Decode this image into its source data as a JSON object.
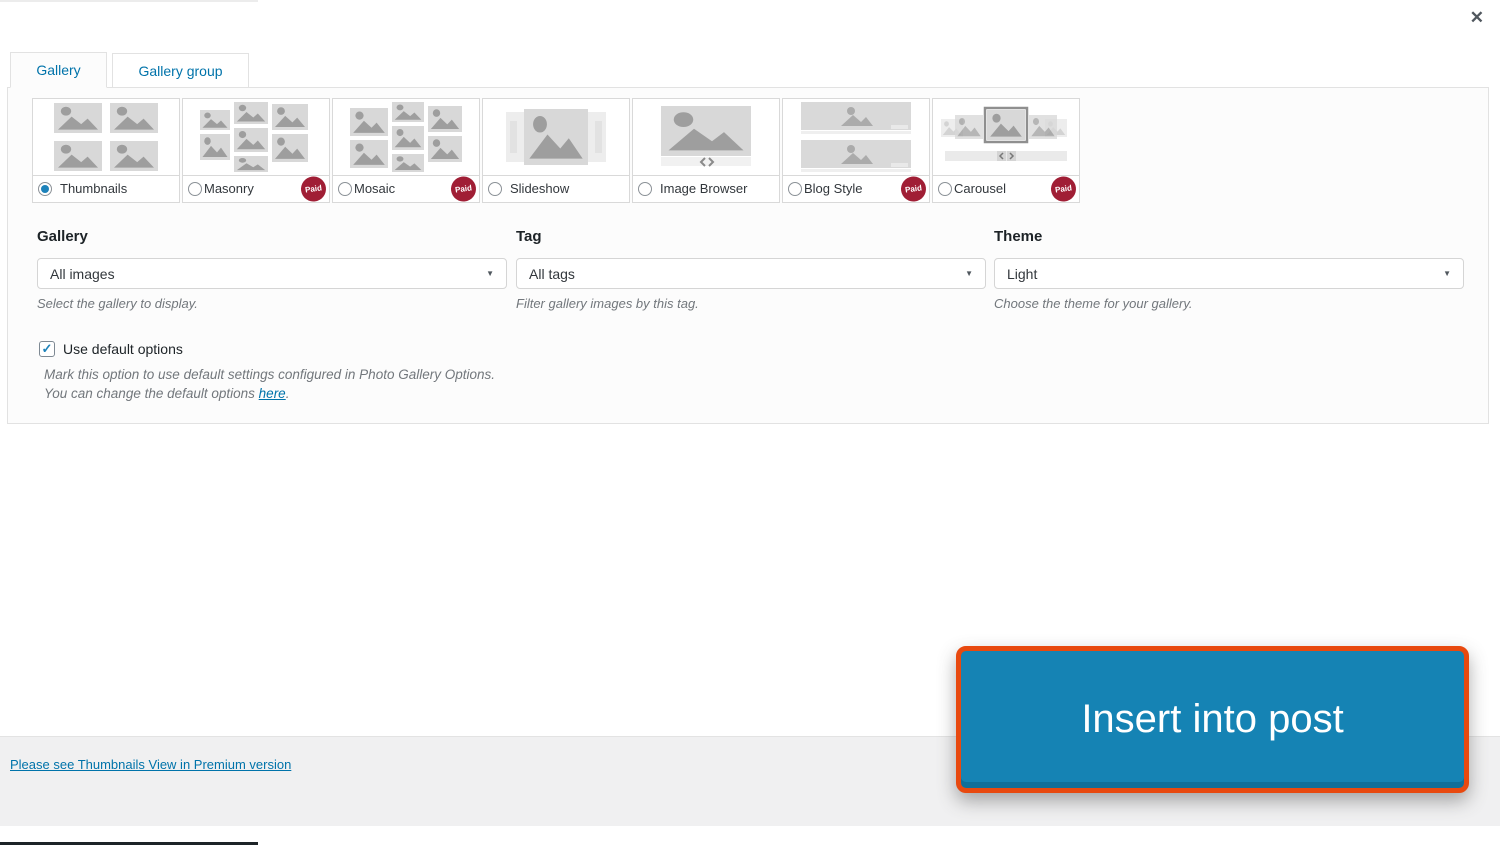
{
  "window": {
    "close_icon": "✕"
  },
  "tabs": [
    {
      "label": "Gallery",
      "active": true
    },
    {
      "label": "Gallery group",
      "active": false
    }
  ],
  "gallery_types": [
    {
      "label": "Thumbnails",
      "selected": true,
      "paid": false
    },
    {
      "label": "Masonry",
      "selected": false,
      "paid": true
    },
    {
      "label": "Mosaic",
      "selected": false,
      "paid": true
    },
    {
      "label": "Slideshow",
      "selected": false,
      "paid": false
    },
    {
      "label": "Image Browser",
      "selected": false,
      "paid": false
    },
    {
      "label": "Blog Style",
      "selected": false,
      "paid": true
    },
    {
      "label": "Carousel",
      "selected": false,
      "paid": true
    }
  ],
  "badges": {
    "paid": "Paid"
  },
  "form": {
    "gallery": {
      "label": "Gallery",
      "value": "All images",
      "help": "Select the gallery to display."
    },
    "tag": {
      "label": "Tag",
      "value": "All tags",
      "help": "Filter gallery images by this tag."
    },
    "theme": {
      "label": "Theme",
      "value": "Light",
      "help": "Choose the theme for your gallery."
    }
  },
  "default_options": {
    "checked": true,
    "checkbox_glyph": "✓",
    "label": "Use default options",
    "description_line1": "Mark this option to use default settings configured in Photo Gallery Options.",
    "description_line2_prefix": "You can change the default options ",
    "description_link": "here",
    "description_suffix": "."
  },
  "footer": {
    "premium_link": "Please see Thumbnails View in Premium version"
  },
  "insert_button": {
    "label": "Insert into post"
  },
  "icons": {
    "dropdown_arrow": "▼"
  },
  "colors": {
    "accent_blue": "#0073aa",
    "radio_selected_blue": "#1d82ba",
    "paid_badge_red": "#a01e35",
    "button_blue": "#1583b4",
    "highlight_orange": "#e8490f",
    "footer_gray": "#f0f0f1"
  }
}
